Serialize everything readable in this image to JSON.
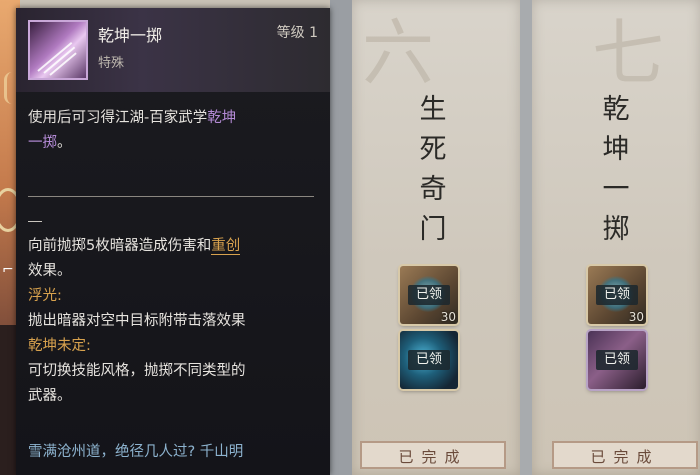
{
  "tooltip": {
    "item_name": "乾坤一掷",
    "level": "等级 1",
    "item_type": "特殊",
    "desc_prefix": "使用后可习得江湖-百家武学",
    "desc_skill_part1": "乾坤",
    "desc_skill_part2": "一掷",
    "desc_suffix": "。",
    "effect_line1_a": "向前抛掷5枚暗器造成伤害和",
    "effect_keyword": "重创",
    "effect_line2": "效果。",
    "fuguang_label": "浮光:",
    "fuguang_text": "抛出暗器对空中目标附带击落效果",
    "qiankun_label": "乾坤未定:",
    "qiankun_text1": "可切换技能风格，抛掷不同类型的",
    "qiankun_text2": "武器。",
    "verse_line": "雪满沧州道，绝径几人过? 千山明"
  },
  "columns": [
    {
      "numeral": "六",
      "title": [
        "生",
        "死",
        "奇",
        "门"
      ],
      "rewards": [
        {
          "label": "已领",
          "count": "30",
          "style": "gold"
        },
        {
          "label": "已领",
          "count": "",
          "style": "blue"
        }
      ],
      "status": "已完成"
    },
    {
      "numeral": "七",
      "title": [
        "乾",
        "坤",
        "一",
        "掷"
      ],
      "rewards": [
        {
          "label": "已领",
          "count": "30",
          "style": "gold"
        },
        {
          "label": "已领",
          "count": "",
          "style": "purple"
        }
      ],
      "status": "已完成"
    }
  ],
  "colors": {
    "skill_highlight": "#b48bd6",
    "gold_label": "#d8a24e",
    "verse": "#8db3cf",
    "panel_bg": "#18181d"
  }
}
